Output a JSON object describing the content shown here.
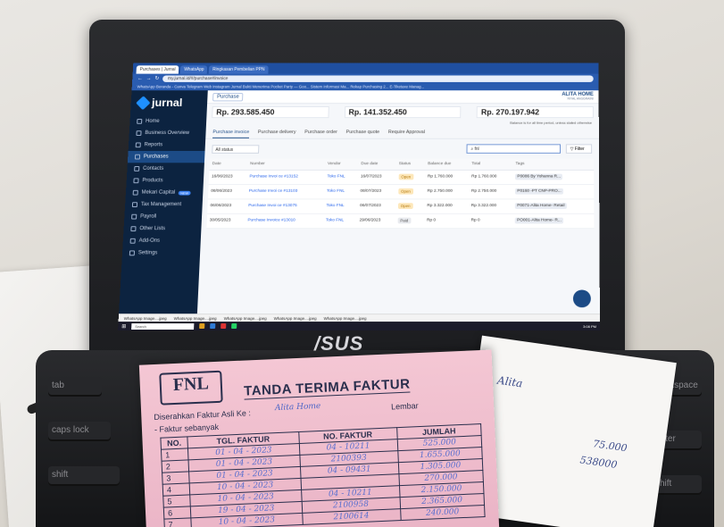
{
  "browser": {
    "tabs": [
      "Purchases | Jurnal",
      "WhatsApp",
      "Ringkasan Pembelian PPN"
    ],
    "url": "my.jurnal.id/#/purchase#invoice",
    "bookmarks": "WhatsApp   Beranda - Canva   Telegram Web   Instagram   Jurnal   Bukti Menerima   Pocket Party — Goo...   Sistem Informasi Ma...   Rekap Purchasing 2...   E-Tiketaxe Manag..."
  },
  "app": {
    "brand": "jurnal",
    "breadcrumb": "Purchase",
    "company_name": "ALITA HOME",
    "company_sub": "RIYAL ANGGRAINI",
    "sidebar": [
      {
        "label": "Home",
        "active": false
      },
      {
        "label": "Business Overview",
        "active": false
      },
      {
        "label": "Reports",
        "active": false
      },
      {
        "label": "Purchases",
        "active": true
      },
      {
        "label": "Contacts",
        "active": false
      },
      {
        "label": "Products",
        "active": false
      },
      {
        "label": "Mekari Capital",
        "active": false,
        "badge": "NEW"
      },
      {
        "label": "Tax Management",
        "active": false
      },
      {
        "label": "Payroll",
        "active": false
      },
      {
        "label": "Other Lists",
        "active": false
      },
      {
        "label": "Add-Ons",
        "active": false
      },
      {
        "label": "Settings",
        "active": false
      }
    ],
    "summary": [
      "Rp. 293.585.450",
      "Rp. 141.352.450",
      "Rp. 270.197.942"
    ],
    "summary_note": "Balance is for all time period, unless stated otherwise",
    "tabs": [
      {
        "label": "Purchase invoice",
        "active": true
      },
      {
        "label": "Purchase delivery",
        "active": false
      },
      {
        "label": "Purchase order",
        "active": false
      },
      {
        "label": "Purchase quote",
        "active": false
      },
      {
        "label": "Require Approval",
        "active": false
      }
    ],
    "status_filter": "All status",
    "search_value": "fnl",
    "filter_label": "Filter",
    "columns": [
      "Date",
      "Number",
      "Vendor",
      "Due date",
      "Status",
      "Balance due",
      "Total",
      "Tags"
    ],
    "rows": [
      {
        "date": "16/06/2023",
        "number": "Purchase Invoi ce #13152",
        "vendor": "Toko FNL",
        "due": "16/07/2023",
        "status": "Open",
        "balance": "Rp 1.760.000",
        "total": "Rp 1.760.000",
        "tags": "P0086 By Yohanna R..."
      },
      {
        "date": "08/06/2023",
        "number": "Purchase Invoi ce #13103",
        "vendor": "Toko FNL",
        "due": "08/07/2023",
        "status": "Open",
        "balance": "Rp 2.750.000",
        "total": "Rp 2.750.000",
        "tags": "P0160 -PT CNP-PRO..."
      },
      {
        "date": "06/06/2023",
        "number": "Purchase Invoi ce #13075",
        "vendor": "Toko FNL",
        "due": "06/07/2023",
        "status": "Open",
        "balance": "Rp 3.322.000",
        "total": "Rp 3.322.000",
        "tags": "P0071-Alita Home- Retail"
      },
      {
        "date": "30/05/2023",
        "number": "Purchase Invoice #13010",
        "vendor": "Toko FNL",
        "due": "29/06/2023",
        "status": "Paid",
        "balance": "Rp 0",
        "total": "Rp 0",
        "tags": "PO001-Alita Home- R..."
      }
    ],
    "downloads": [
      "WhatsApp Image....jpeg",
      "WhatsApp Image....jpeg",
      "WhatsApp Image....jpeg",
      "WhatsApp Image....jpeg",
      "WhatsApp Image....jpeg"
    ],
    "taskbar_search": "Search",
    "clock": "3:08 PM"
  },
  "laptop": {
    "brand": "/SUS"
  },
  "faktur": {
    "logo": "FNL",
    "title": "TANDA TERIMA FAKTUR",
    "diserahkan_label": "Diserahkan Faktur Asli Ke :",
    "diserahkan_value": "Alita Home",
    "lembar_label": "Lembar",
    "sebanyak_label": "- Faktur sebanyak",
    "columns": [
      "NO.",
      "TGL. FAKTUR",
      "NO. FAKTUR",
      "JUMLAH"
    ],
    "rows": [
      {
        "no": "1",
        "tgl": "01 - 04 - 2023",
        "nofaktur": "04 - 10211",
        "jumlah": "525.000"
      },
      {
        "no": "2",
        "tgl": "01 - 04 - 2023",
        "nofaktur": "2100393",
        "jumlah": "1.655.000"
      },
      {
        "no": "3",
        "tgl": "01 - 04 - 2023",
        "nofaktur": "04 - 09431",
        "jumlah": "1.305.000"
      },
      {
        "no": "4",
        "tgl": "10 - 04 - 2023",
        "nofaktur": "",
        "jumlah": "270.000"
      },
      {
        "no": "5",
        "tgl": "10 - 04 - 2023",
        "nofaktur": "04 - 10211",
        "jumlah": "2.150.000"
      },
      {
        "no": "6",
        "tgl": "19 - 04 - 2023",
        "nofaktur": "2100958",
        "jumlah": "2.365.000"
      },
      {
        "no": "7",
        "tgl": "10 - 04 - 2023",
        "nofaktur": "2100614",
        "jumlah": "240.000"
      }
    ]
  },
  "receipt": {
    "handwritten_1": "Alita",
    "handwritten_2": "75.000",
    "handwritten_3": "538000"
  }
}
